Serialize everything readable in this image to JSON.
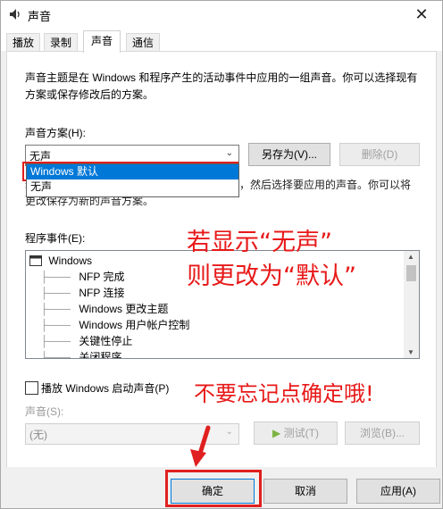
{
  "window": {
    "title": "声音",
    "close_glyph": "✕"
  },
  "tabs": [
    {
      "label": "播放"
    },
    {
      "label": "录制"
    },
    {
      "label": "声音"
    },
    {
      "label": "通信"
    }
  ],
  "description": "声音主题是在 Windows 和程序产生的活动事件中应用的一组声音。你可以选择现有方案或保存修改后的方案。",
  "scheme": {
    "label": "声音方案(H):",
    "value": "无声",
    "options": [
      "Windows 默认",
      "无声"
    ],
    "save_as_label": "另存为(V)...",
    "delete_label": "删除(D)"
  },
  "description2": "若要更改声音，请单击以下列表中的程序事件，然后选择要应用的声音。你可以将更改保存为新的声音方案。",
  "events": {
    "label": "程序事件(E):",
    "items": [
      "Windows",
      "NFP 完成",
      "NFP 连接",
      "Windows 更改主题",
      "Windows 用户帐户控制",
      "关键性停止",
      "关闭程序"
    ]
  },
  "startup_sound": {
    "label": "播放 Windows 启动声音(P)",
    "checked": false
  },
  "sound": {
    "label": "声音(S):",
    "value": "(无)",
    "test_label": "测试(T)",
    "browse_label": "浏览(B)..."
  },
  "footer": {
    "ok_label": "确定",
    "cancel_label": "取消",
    "apply_label": "应用(A)"
  },
  "annotations": {
    "line1": "若显示“无声”",
    "line2": "则更改为“默认”",
    "line3": "不要忘记点确定哦!"
  },
  "colors": {
    "annotation": "#e81818",
    "selection": "#0078d7"
  }
}
